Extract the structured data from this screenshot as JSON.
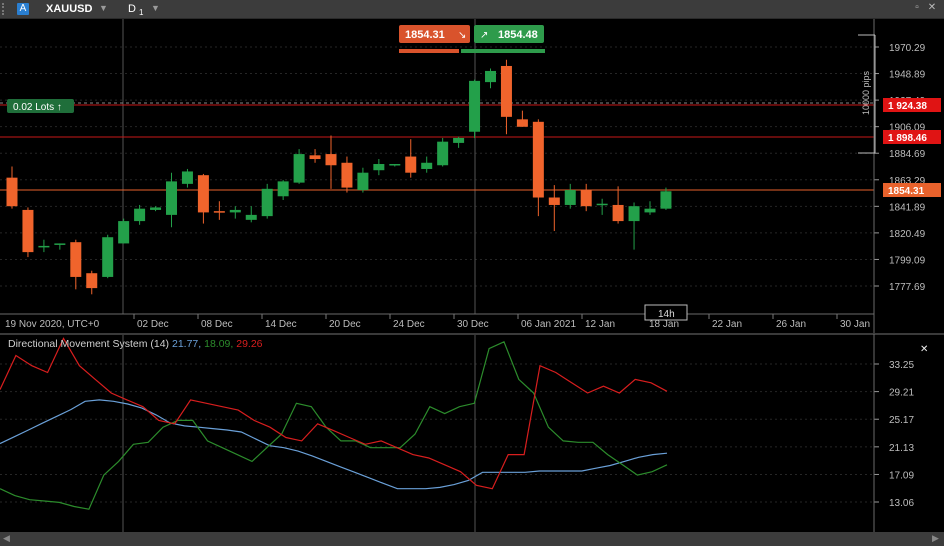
{
  "toolbar": {
    "symbol": "XAUUSD",
    "account_icon": "A",
    "timeframe": "D",
    "timeframe_sub": "1",
    "dropdown_glyph": "▼",
    "restore_glyph": "▫",
    "close_glyph": "✕"
  },
  "trade": {
    "sell_price": "1854.31",
    "buy_price": "1854.48",
    "sell_color": "#d9532c",
    "buy_color": "#2e9b4b"
  },
  "lots": {
    "label": "0.02 Lots ↑"
  },
  "price_axis": {
    "ticks": [
      "1970.29",
      "1948.89",
      "1927.49",
      "1906.09",
      "1884.69",
      "1863.29",
      "1841.89",
      "1820.49",
      "1799.09",
      "1777.69"
    ],
    "pips_label": "10000 pips",
    "markers": [
      {
        "label": "1 924.38",
        "color": "#e01414"
      },
      {
        "label": "1 898.46",
        "color": "#e01414"
      },
      {
        "label": "1854.31",
        "color": "#e8622c"
      }
    ]
  },
  "time_axis": {
    "labels": [
      "19 Nov 2020, UTC+0",
      "02 Dec",
      "08 Dec",
      "14 Dec",
      "20 Dec",
      "24 Dec",
      "30 Dec",
      "06 Jan 2021",
      "12 Jan",
      "18 Jan",
      "22 Jan",
      "26 Jan",
      "30 Jan"
    ],
    "cursor_label": "14h"
  },
  "indicator": {
    "title": "Directional Movement System (14)",
    "adx": "21.77",
    "plus_di": "18.09",
    "minus_di": "29.26",
    "ticks": [
      "33.25",
      "29.21",
      "25.17",
      "21.13",
      "17.09",
      "13.06"
    ],
    "close_glyph": "✕"
  },
  "colors": {
    "bull": "#23a04a",
    "bear": "#f0642c",
    "adx": "#6aa0d8",
    "plus_di": "#2c8c2c",
    "minus_di": "#d81e1e"
  },
  "chart_data": {
    "type": "candlestick",
    "symbol": "XAUUSD",
    "timeframe": "D1",
    "candles": [
      {
        "o": 1865,
        "h": 1874,
        "l": 1840,
        "c": 1842
      },
      {
        "o": 1839,
        "h": 1841,
        "l": 1801,
        "c": 1805
      },
      {
        "o": 1810,
        "h": 1815,
        "l": 1805,
        "c": 1810
      },
      {
        "o": 1811,
        "h": 1812,
        "l": 1807,
        "c": 1812
      },
      {
        "o": 1813,
        "h": 1815,
        "l": 1775,
        "c": 1785
      },
      {
        "o": 1788,
        "h": 1790,
        "l": 1771,
        "c": 1776
      },
      {
        "o": 1785,
        "h": 1819,
        "l": 1784,
        "c": 1817
      },
      {
        "o": 1812,
        "h": 1832,
        "l": 1812,
        "c": 1830
      },
      {
        "o": 1830,
        "h": 1843,
        "l": 1827,
        "c": 1840
      },
      {
        "o": 1839,
        "h": 1842,
        "l": 1838,
        "c": 1841
      },
      {
        "o": 1835,
        "h": 1869,
        "l": 1825,
        "c": 1862
      },
      {
        "o": 1860,
        "h": 1872,
        "l": 1857,
        "c": 1870
      },
      {
        "o": 1867,
        "h": 1868,
        "l": 1828,
        "c": 1837
      },
      {
        "o": 1838,
        "h": 1846,
        "l": 1831,
        "c": 1837
      },
      {
        "o": 1837,
        "h": 1842,
        "l": 1832,
        "c": 1839
      },
      {
        "o": 1831,
        "h": 1842,
        "l": 1829,
        "c": 1835
      },
      {
        "o": 1834,
        "h": 1860,
        "l": 1832,
        "c": 1856
      },
      {
        "o": 1850,
        "h": 1863,
        "l": 1847,
        "c": 1862
      },
      {
        "o": 1861,
        "h": 1888,
        "l": 1860,
        "c": 1884
      },
      {
        "o": 1883,
        "h": 1888,
        "l": 1877,
        "c": 1880
      },
      {
        "o": 1884,
        "h": 1899,
        "l": 1856,
        "c": 1875
      },
      {
        "o": 1877,
        "h": 1882,
        "l": 1853,
        "c": 1857
      },
      {
        "o": 1855,
        "h": 1873,
        "l": 1853,
        "c": 1869
      },
      {
        "o": 1871,
        "h": 1880,
        "l": 1867,
        "c": 1876
      },
      {
        "o": 1876,
        "h": 1876,
        "l": 1874,
        "c": 1876
      },
      {
        "o": 1882,
        "h": 1896,
        "l": 1865,
        "c": 1869
      },
      {
        "o": 1872,
        "h": 1882,
        "l": 1869,
        "c": 1877
      },
      {
        "o": 1875,
        "h": 1897,
        "l": 1874,
        "c": 1894
      },
      {
        "o": 1893,
        "h": 1898,
        "l": 1889,
        "c": 1897
      },
      {
        "o": 1902,
        "h": 1944,
        "l": 1897,
        "c": 1943
      },
      {
        "o": 1942,
        "h": 1953,
        "l": 1937,
        "c": 1951
      },
      {
        "o": 1955,
        "h": 1960,
        "l": 1900,
        "c": 1914
      },
      {
        "o": 1912,
        "h": 1919,
        "l": 1906,
        "c": 1906
      },
      {
        "o": 1910,
        "h": 1912,
        "l": 1834,
        "c": 1849
      },
      {
        "o": 1849,
        "h": 1859,
        "l": 1822,
        "c": 1843
      },
      {
        "o": 1843,
        "h": 1860,
        "l": 1840,
        "c": 1855
      },
      {
        "o": 1855,
        "h": 1860,
        "l": 1838,
        "c": 1842
      },
      {
        "o": 1843,
        "h": 1848,
        "l": 1835,
        "c": 1844
      },
      {
        "o": 1843,
        "h": 1858,
        "l": 1828,
        "c": 1830
      },
      {
        "o": 1830,
        "h": 1845,
        "l": 1807,
        "c": 1842
      },
      {
        "o": 1837,
        "h": 1846,
        "l": 1835,
        "c": 1840
      },
      {
        "o": 1840,
        "h": 1857,
        "l": 1839,
        "c": 1854
      }
    ],
    "series": [
      {
        "name": "ADX",
        "values": [
          21.6,
          22.6,
          23.6,
          24.6,
          25.6,
          26.6,
          27.8,
          28.0,
          27.8,
          27.4,
          26.8,
          25.8,
          24.6,
          24.2,
          24.0,
          23.8,
          23.6,
          23.3,
          22.3,
          21.3,
          21.0,
          20.5,
          19.8,
          19.0,
          18.2,
          17.4,
          16.6,
          15.8,
          15.0,
          15.0,
          15.0,
          15.2,
          15.6,
          16.2,
          17.4,
          17.4,
          17.4,
          17.4,
          17.6,
          17.6,
          17.6,
          17.6,
          18.0,
          18.4,
          19.0,
          19.6,
          20.0,
          20.2
        ],
        "color": "#6aa0d8"
      },
      {
        "name": "+DI",
        "values": [
          15.0,
          14.0,
          13.4,
          13.2,
          13.0,
          12.4,
          12.0,
          17.0,
          19.0,
          21.5,
          21.8,
          24.0,
          25.0,
          25.0,
          22.0,
          21.0,
          20.0,
          19.0,
          21.0,
          23.0,
          27.5,
          27.0,
          24.0,
          22.0,
          22.0,
          21.0,
          21.0,
          21.0,
          23.0,
          27.0,
          26.0,
          27.0,
          27.5,
          35.5,
          36.5,
          31.0,
          29.0,
          24.0,
          22.0,
          21.8,
          21.8,
          20.0,
          18.5,
          17.0,
          17.5,
          18.5
        ],
        "color": "#2c8c2c"
      },
      {
        "name": "-DI",
        "values": [
          29.5,
          34.5,
          33.0,
          32.0,
          37.0,
          33.0,
          31.0,
          29.0,
          28.0,
          27.0,
          25.0,
          24.5,
          28.0,
          27.5,
          27.0,
          26.5,
          25.0,
          24.0,
          22.5,
          22.0,
          24.5,
          23.5,
          22.5,
          21.5,
          22.0,
          21.0,
          20.0,
          19.5,
          18.5,
          17.5,
          15.5,
          15.0,
          20.0,
          20.0,
          33.0,
          32.0,
          30.5,
          29.0,
          30.0,
          29.0,
          31.0,
          30.5,
          29.26
        ],
        "color": "#d81e1e"
      }
    ]
  }
}
